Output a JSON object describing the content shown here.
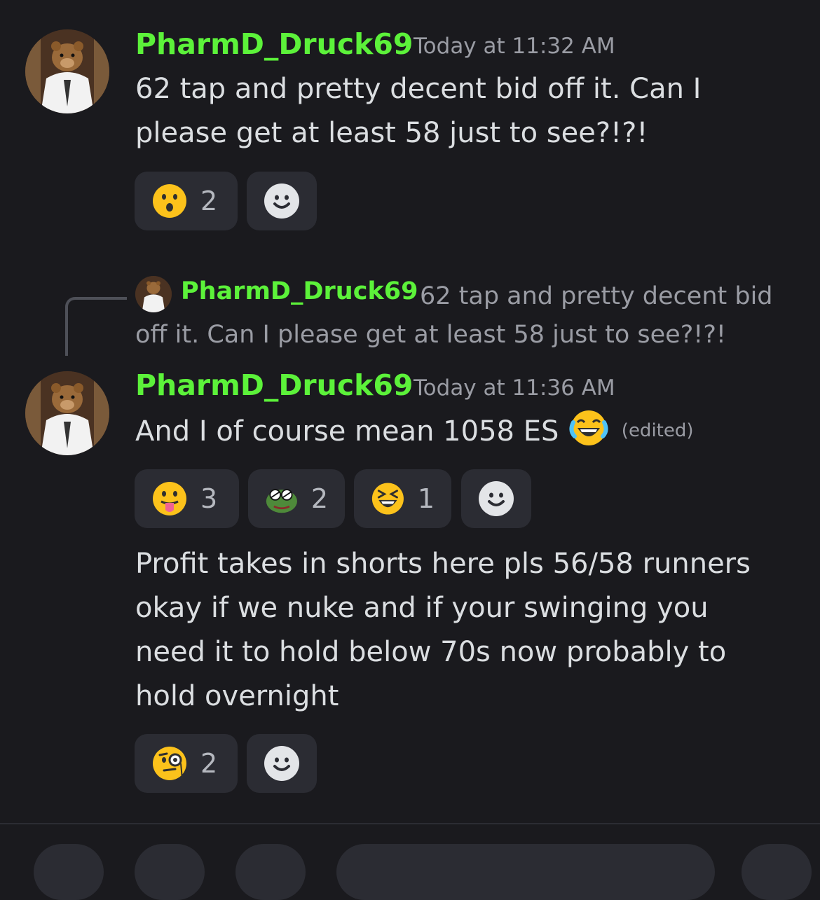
{
  "messages": [
    {
      "username": "PharmD_Druck69",
      "timestamp": "Today at 11:32 AM",
      "text": "62 tap and pretty decent bid off it. Can I please get at least 58 just to see?!?!",
      "reactions": [
        {
          "emoji": "hushed-face",
          "count": "2"
        }
      ]
    },
    {
      "reply": {
        "username": "PharmD_Druck69",
        "text": "62 tap and pretty decent bid off it. Can I please get at least 58 just to see?!?!"
      },
      "username": "PharmD_Druck69",
      "timestamp": "Today at 11:36 AM",
      "text": "And I of course mean 1058 ES",
      "text_emoji": "joy-face",
      "edited": "(edited)",
      "reactions": [
        {
          "emoji": "tongue-face",
          "count": "3"
        },
        {
          "emoji": "pepe-sunglasses",
          "count": "2"
        },
        {
          "emoji": "laughing-face",
          "count": "1"
        }
      ]
    },
    {
      "text": "Profit takes in shorts here pls 56/58 runners okay if we nuke and if your swinging you need it to hold below 70s now probably to hold overnight",
      "reactions": [
        {
          "emoji": "monocle-face",
          "count": "2"
        }
      ]
    }
  ],
  "colors": {
    "background": "#1a1a1e",
    "username": "#5cf23a",
    "pill": "#2b2c33",
    "muted": "#9a9ca4"
  }
}
